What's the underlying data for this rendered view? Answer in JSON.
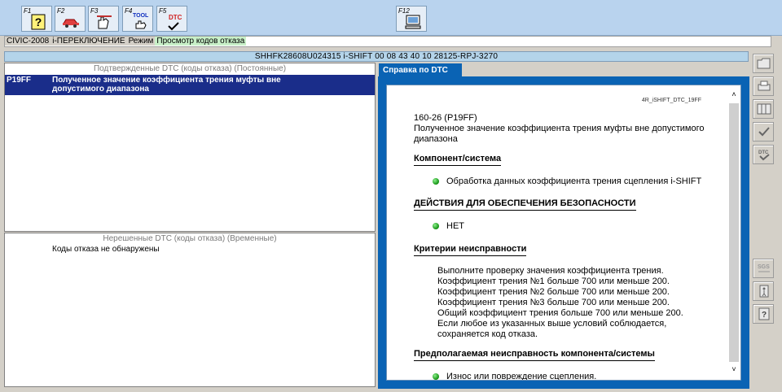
{
  "toolbar": {
    "fkeys": [
      {
        "label": "F1",
        "icon": "help-icon"
      },
      {
        "label": "F2",
        "icon": "car-icon"
      },
      {
        "label": "F3",
        "icon": "hand-tool-icon"
      },
      {
        "label": "F4",
        "icon": "tool-icon",
        "text": "TOOL"
      },
      {
        "label": "F5",
        "icon": "dtc-icon",
        "text": "DTC"
      },
      {
        "label": "F12",
        "icon": "computer-icon"
      }
    ]
  },
  "status": {
    "model": "CIVIC-2008",
    "system": "i-ПЕРЕКЛЮЧЕНИЕ",
    "mode_label": "Режим",
    "mode_value": "Просмотр кодов отказа"
  },
  "info": "SHHFK28608U024315  i-SHIFT  00 08 43 40 10  28125-RPJ-3270",
  "confirmed": {
    "title": "Подтвержденные DTC (коды отказа) (Постоянные)",
    "items": [
      {
        "code": "P19FF",
        "description": "Полученное значение коэффициента трения муфты вне допустимого диапазона"
      }
    ]
  },
  "pending": {
    "title": "Нерешенные DTC (коды отказа) (Временные)",
    "message": "Коды отказа не обнаружены"
  },
  "tab": {
    "label": "Справка по DTC"
  },
  "doc": {
    "id": "4R_iSHIFT_DTC_19FF",
    "code": "160-26 (P19FF)",
    "title": "Полученное значение коэффициента трения муфты вне допустимого диапазона",
    "component_heading": "Компонент/система",
    "component_item": "Обработка данных коэффициента трения сцепления i-SHIFT",
    "safety_heading": "ДЕЙСТВИЯ ДЛЯ ОБЕСПЕЧЕНИЯ БЕЗОПАСНОСТИ",
    "safety_item": "НЕТ",
    "criteria_heading": "Критерии неисправности",
    "criteria": [
      "Выполните проверку значения коэффициента трения.",
      "Коэффициент трения №1 больше 700 или меньше 200.",
      "Коэффициент трения №2 больше 700 или меньше 200.",
      "Коэффициент трения №3 больше 700 или меньше 200.",
      "Общий коэффициент трения больше 700 или меньше 200.",
      "Если любое из указанных выше условий соблюдается,",
      "сохраняется код отказа."
    ],
    "fault_heading": "Предполагаемая неисправность компонента/системы",
    "fault_item": "Износ или повреждение сцепления."
  },
  "colors": {
    "accent": "#0a63b4",
    "selection": "#1a2d8a",
    "header": "#b4d4ea"
  }
}
